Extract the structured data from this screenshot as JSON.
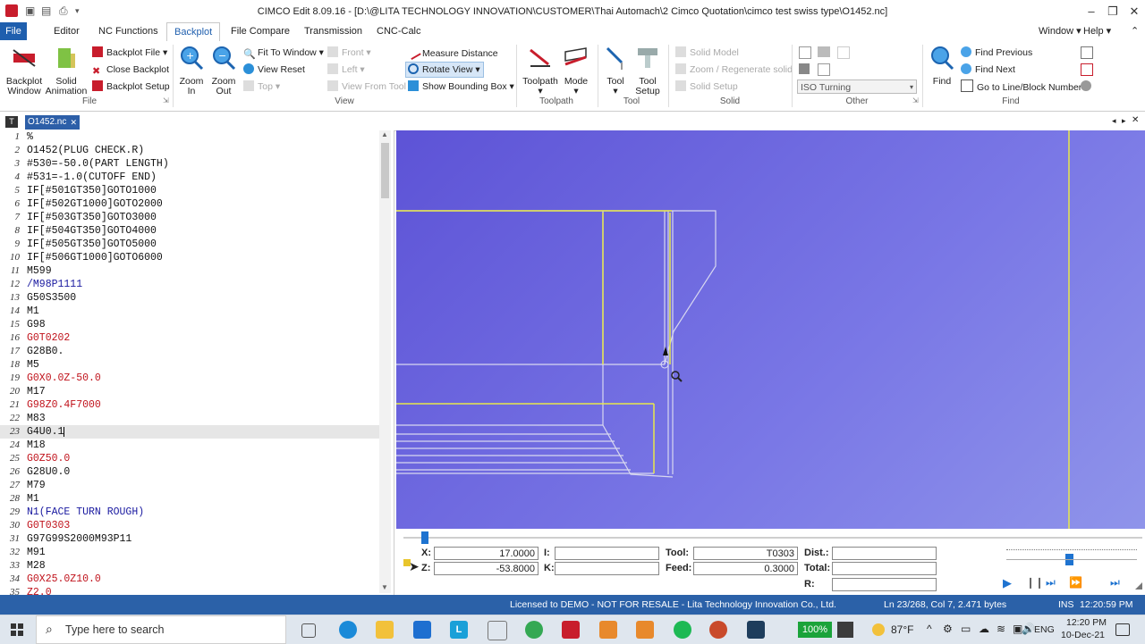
{
  "window": {
    "title": "CIMCO Edit 8.09.16 - [D:\\@LITA TECHNOLOGY INNOVATION\\CUSTOMER\\Thai Automach\\2 Cimco Quotation\\cimco test swiss type\\O1452.nc]",
    "minimize": "–",
    "restore": "❐",
    "close": "✕"
  },
  "menu": {
    "tabs": [
      "File",
      "Editor",
      "NC Functions",
      "Backplot",
      "File Compare",
      "Transmission",
      "CNC-Calc"
    ],
    "active_tab": "Backplot",
    "right_items": [
      "Window",
      "Help"
    ]
  },
  "ribbon": {
    "backplot_group": {
      "label": "File",
      "backplot_window": "Backplot Window",
      "solid_animation": "Solid Animation",
      "backplot_file": "Backplot File",
      "close_backplot": "Close Backplot",
      "backplot_setup": "Backplot Setup"
    },
    "view_group": {
      "label": "View",
      "zoom_in": "Zoom In",
      "zoom_out": "Zoom Out",
      "fit_to_window": "Fit To Window",
      "view_reset": "View Reset",
      "top": "Top",
      "front": "Front",
      "left": "Left",
      "view_from_tool": "View From Tool",
      "measure_distance": "Measure Distance",
      "rotate_view": "Rotate View",
      "show_bounding_box": "Show Bounding Box"
    },
    "toolpath_group": {
      "label": "Toolpath",
      "toolpath": "Toolpath",
      "mode": "Mode"
    },
    "tool_group": {
      "label": "Tool",
      "tool": "Tool",
      "tool_setup": "Tool Setup"
    },
    "solid_group": {
      "label": "Solid",
      "solid_model": "Solid Model",
      "zoom_regenerate": "Zoom / Regenerate solid",
      "solid_setup": "Solid Setup"
    },
    "other_group": {
      "label": "Other",
      "machine_select": "ISO Turning"
    },
    "find_group": {
      "label": "Find",
      "find": "Find",
      "find_previous": "Find Previous",
      "find_next": "Find Next",
      "goto_line": "Go to Line/Block Number"
    }
  },
  "document_tab": "O1452.nc",
  "editor": {
    "lines": [
      {
        "n": "1",
        "text": "%",
        "color": "black"
      },
      {
        "n": "2",
        "text": "O1452(PLUG CHECK.R)",
        "color": "black"
      },
      {
        "n": "3",
        "text": "#530=-50.0(PART LENGTH)",
        "color": "black"
      },
      {
        "n": "4",
        "text": "#531=-1.0(CUTOFF END)",
        "color": "black"
      },
      {
        "n": "5",
        "text": "IF[#501GT350]GOTO1000",
        "color": "black"
      },
      {
        "n": "6",
        "text": "IF[#502GT1000]GOTO2000",
        "color": "black"
      },
      {
        "n": "7",
        "text": "IF[#503GT350]GOTO3000",
        "color": "black"
      },
      {
        "n": "8",
        "text": "IF[#504GT350]GOTO4000",
        "color": "black"
      },
      {
        "n": "9",
        "text": "IF[#505GT350]GOTO5000",
        "color": "black"
      },
      {
        "n": "10",
        "text": "IF[#506GT1000]GOTO6000",
        "color": "black"
      },
      {
        "n": "11",
        "text": "M599",
        "color": "black"
      },
      {
        "n": "12",
        "text": "/M98P1111",
        "color": "blue"
      },
      {
        "n": "13",
        "text": "G50S3500",
        "color": "black"
      },
      {
        "n": "14",
        "text": "M1",
        "color": "black"
      },
      {
        "n": "15",
        "text": "G98",
        "color": "black"
      },
      {
        "n": "16",
        "text": "G0T0202",
        "color": "red"
      },
      {
        "n": "17",
        "text": "G28B0.",
        "color": "black"
      },
      {
        "n": "18",
        "text": "M5",
        "color": "black"
      },
      {
        "n": "19",
        "text": "G0X0.0Z-50.0",
        "color": "red"
      },
      {
        "n": "20",
        "text": "M17",
        "color": "black"
      },
      {
        "n": "21",
        "text": "G98Z0.4F7000",
        "color": "red"
      },
      {
        "n": "22",
        "text": "M83",
        "color": "black"
      },
      {
        "n": "23",
        "text": "G4U0.1",
        "color": "black"
      },
      {
        "n": "24",
        "text": "M18",
        "color": "black"
      },
      {
        "n": "25",
        "text": "G0Z50.0",
        "color": "red"
      },
      {
        "n": "26",
        "text": "G28U0.0",
        "color": "black"
      },
      {
        "n": "27",
        "text": "M79",
        "color": "black"
      },
      {
        "n": "28",
        "text": "M1",
        "color": "black"
      },
      {
        "n": "29",
        "text": "N1(FACE TURN ROUGH)",
        "color": "blue"
      },
      {
        "n": "30",
        "text": "G0T0303",
        "color": "red"
      },
      {
        "n": "31",
        "text": "G97G99S2000M93P11",
        "color": "black"
      },
      {
        "n": "32",
        "text": "M91",
        "color": "black"
      },
      {
        "n": "33",
        "text": "M28",
        "color": "black"
      },
      {
        "n": "34",
        "text": "G0X25.0Z10.0",
        "color": "red"
      },
      {
        "n": "35",
        "text": "Z2.0",
        "color": "red"
      }
    ],
    "current_line": "23"
  },
  "readout": {
    "x_label": "X:",
    "x_value": "17.0000",
    "z_label": "Z:",
    "z_value": "-53.8000",
    "i_label": "I:",
    "i_value": "",
    "k_label": "K:",
    "k_value": "",
    "tool_label": "Tool:",
    "tool_value": "T0303",
    "feed_label": "Feed:",
    "feed_value": "0.3000",
    "dist_label": "Dist.:",
    "dist_value": "",
    "total_label": "Total:",
    "total_value": "",
    "r_label": "R:",
    "r_value": ""
  },
  "status": {
    "license": "Licensed to DEMO - NOT FOR RESALE - Lita Technology Innovation Co., Ltd.",
    "position": "Ln 23/268, Col 7, 2.471 bytes",
    "mode": "INS",
    "clock": "12:20:59 PM"
  },
  "taskbar": {
    "search_placeholder": "Type here to search",
    "battery": "100%",
    "weather": "87°F",
    "language": "ENG",
    "time": "12:20 PM",
    "date": "10-Dec-21"
  },
  "colors": {
    "accent_blue": "#2b61a8",
    "toolpath_yellow": "#e8e84a",
    "viewport_blue": "#6a66de"
  }
}
